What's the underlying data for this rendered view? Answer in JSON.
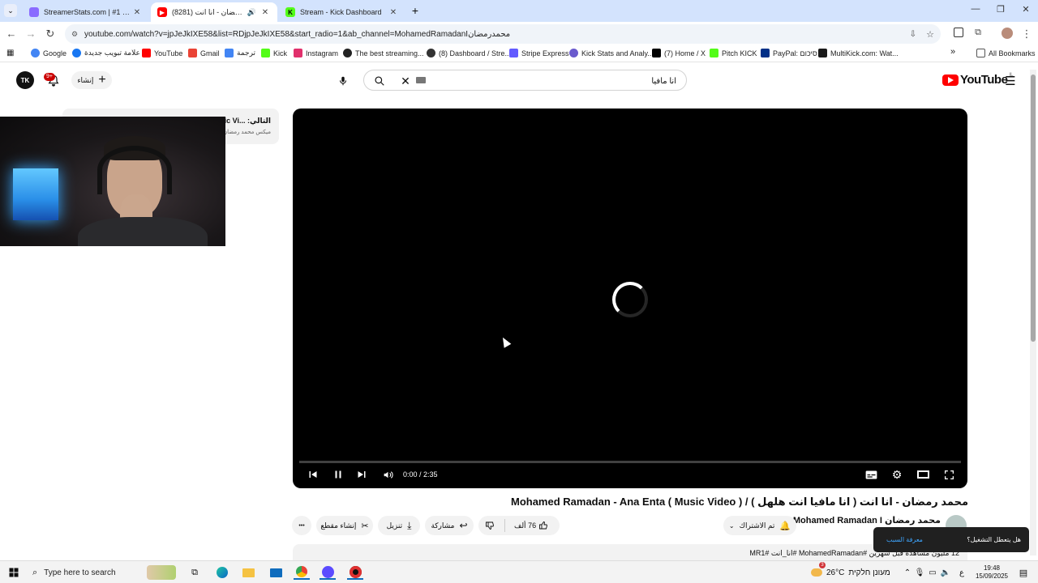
{
  "browser": {
    "tabs": [
      {
        "title": "StreamerStats.com | #1 Kick An",
        "color": "#8a6cff",
        "active": false
      },
      {
        "title": "محمد رمضان - انا انت (8281)",
        "color": "#ff0000",
        "active": true
      },
      {
        "title": "Stream - Kick Dashboard",
        "color": "#53fc18",
        "active": false
      }
    ],
    "new_tab_label": "+",
    "url": "youtube.com/watch?v=jpJeJkIXE58&list=RDjpJeJkIXE58&start_radio=1&ab_channel=MohamedRamadanIمحمدرمضان",
    "bookmarks": [
      {
        "label": "Google",
        "color": "#4285f4"
      },
      {
        "label": "علامة تبويب جديدة",
        "color": "#1877f2"
      },
      {
        "label": "YouTube",
        "color": "#ff0000"
      },
      {
        "label": "Gmail",
        "color": "#ea4335"
      },
      {
        "label": "ترجمة",
        "color": "#4285f4"
      },
      {
        "label": "Kick",
        "color": "#53fc18"
      },
      {
        "label": "Instagram",
        "color": "#e1306c"
      },
      {
        "label": "The best streaming...",
        "color": "#222222"
      },
      {
        "label": "(8) Dashboard / Stre...",
        "color": "#333333"
      },
      {
        "label": "Stripe Express",
        "color": "#635bff"
      },
      {
        "label": "Kick Stats and Analy...",
        "color": "#6a5acd"
      },
      {
        "label": "(7) Home / X",
        "color": "#000000"
      },
      {
        "label": "Pitch KICK",
        "color": "#53fc18"
      },
      {
        "label": "PayPal: סיכום",
        "color": "#003087"
      },
      {
        "label": "MultiKick.com: Wat...",
        "color": "#1a1a1a"
      }
    ],
    "more_bookmarks": "»",
    "all_bookmarks": "All Bookmarks"
  },
  "youtube": {
    "avatar_initials": "TK",
    "notifications_count": "9+",
    "create_label": "إنشاء",
    "search_value": "انا مافيا",
    "logo_text": "YouTube",
    "logo_region": "IL",
    "side_card": {
      "title": "التالي: ...Music Vi",
      "subtitle": "ميكس محمد رمضان"
    },
    "player": {
      "time": "0:00 / 2:35"
    },
    "video_title": "محمد رمضان - انا انت ( انا مافيا انت هلهل ) / Mohamed Ramadan - Ana Enta ( Music Video )",
    "channel_name": "Mohamed Ramadan I محمد رمضان",
    "subscribe_label": "تم الاشتراك",
    "like_count": "76 ألف",
    "share_label": "مشاركة",
    "download_label": "تنزيل",
    "clip_label": "إنشاء مقطع",
    "more_label": "•••",
    "description": "12 مليون مشاهدة قبل شهرين #MohamedRamadan #انا_انت #MR1",
    "toast": {
      "question": "هل يتعطل التشغيل؟",
      "link": "معرفة السبب"
    }
  },
  "taskbar": {
    "search_placeholder": "Type here to search",
    "weather_temp": "26°C",
    "weather_text": "מעונן חלקית",
    "lang": "ع",
    "time": "19:48",
    "date": "15/09/2025",
    "notif_count": "3"
  },
  "colors": {
    "yt_red": "#ff0000",
    "tab_strip": "#d3e3fd",
    "player_bg": "#000000"
  }
}
